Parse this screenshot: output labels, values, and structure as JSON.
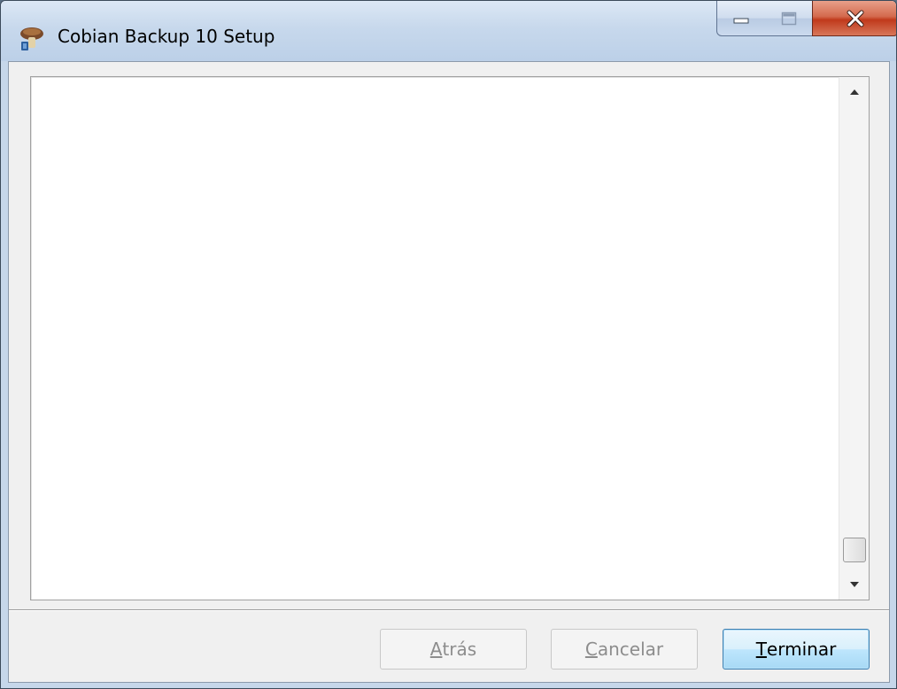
{
  "window": {
    "title": "Cobian Backup 10 Setup",
    "app_icon": "cobian-backup-icon",
    "caption_buttons": [
      "minimize",
      "maximize",
      "close"
    ]
  },
  "memo": {
    "text": "",
    "scroll_position_fraction": 0.95
  },
  "buttons": {
    "back": {
      "accel": "A",
      "rest": "trás",
      "enabled": false
    },
    "cancel": {
      "accel": "C",
      "rest": "ancelar",
      "enabled": false
    },
    "finish": {
      "accel": "T",
      "rest": "erminar",
      "enabled": true,
      "default": true
    }
  },
  "colors": {
    "titlebar": "#c7d8ec",
    "close_button": "#c0391b",
    "default_button_border": "#3c7fb1"
  }
}
